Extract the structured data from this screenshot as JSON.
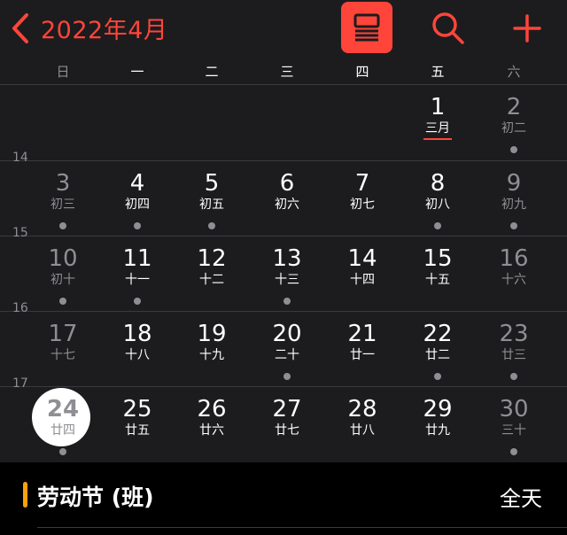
{
  "header": {
    "title": "2022年4月",
    "icons": {
      "back": "chevron-left-icon",
      "list": "list-view-icon",
      "search": "search-icon",
      "add": "plus-icon"
    },
    "accent": "#ff453a"
  },
  "weekdays": [
    "日",
    "一",
    "二",
    "三",
    "四",
    "五",
    "六"
  ],
  "weeks": [
    {
      "num": "",
      "days": [
        {
          "day": "",
          "lunar": "",
          "dot": false
        },
        {
          "day": "",
          "lunar": "",
          "dot": false
        },
        {
          "day": "",
          "lunar": "",
          "dot": false
        },
        {
          "day": "",
          "lunar": "",
          "dot": false
        },
        {
          "day": "",
          "lunar": "",
          "dot": false
        },
        {
          "day": "1",
          "lunar": "三月",
          "dot": false,
          "underline": true
        },
        {
          "day": "2",
          "lunar": "初二",
          "dot": true
        }
      ]
    },
    {
      "num": "14",
      "days": [
        {
          "day": "3",
          "lunar": "初三",
          "dot": true
        },
        {
          "day": "4",
          "lunar": "初四",
          "dot": true
        },
        {
          "day": "5",
          "lunar": "初五",
          "dot": true
        },
        {
          "day": "6",
          "lunar": "初六",
          "dot": false
        },
        {
          "day": "7",
          "lunar": "初七",
          "dot": false
        },
        {
          "day": "8",
          "lunar": "初八",
          "dot": true
        },
        {
          "day": "9",
          "lunar": "初九",
          "dot": true
        }
      ]
    },
    {
      "num": "15",
      "days": [
        {
          "day": "10",
          "lunar": "初十",
          "dot": true
        },
        {
          "day": "11",
          "lunar": "十一",
          "dot": true
        },
        {
          "day": "12",
          "lunar": "十二",
          "dot": false
        },
        {
          "day": "13",
          "lunar": "十三",
          "dot": true
        },
        {
          "day": "14",
          "lunar": "十四",
          "dot": false
        },
        {
          "day": "15",
          "lunar": "十五",
          "dot": false
        },
        {
          "day": "16",
          "lunar": "十六",
          "dot": false
        }
      ]
    },
    {
      "num": "16",
      "days": [
        {
          "day": "17",
          "lunar": "十七",
          "dot": false
        },
        {
          "day": "18",
          "lunar": "十八",
          "dot": false
        },
        {
          "day": "19",
          "lunar": "十九",
          "dot": false
        },
        {
          "day": "20",
          "lunar": "二十",
          "dot": true
        },
        {
          "day": "21",
          "lunar": "廿一",
          "dot": false
        },
        {
          "day": "22",
          "lunar": "廿二",
          "dot": true
        },
        {
          "day": "23",
          "lunar": "廿三",
          "dot": true
        }
      ]
    },
    {
      "num": "17",
      "days": [
        {
          "day": "24",
          "lunar": "廿四",
          "dot": true,
          "today": true
        },
        {
          "day": "25",
          "lunar": "廿五",
          "dot": false
        },
        {
          "day": "26",
          "lunar": "廿六",
          "dot": false
        },
        {
          "day": "27",
          "lunar": "廿七",
          "dot": false
        },
        {
          "day": "28",
          "lunar": "廿八",
          "dot": false
        },
        {
          "day": "29",
          "lunar": "廿九",
          "dot": false
        },
        {
          "day": "30",
          "lunar": "三十",
          "dot": true
        }
      ]
    }
  ],
  "event": {
    "title": "劳动节 (班)",
    "time": "全天",
    "color": "#ff9f0a"
  }
}
